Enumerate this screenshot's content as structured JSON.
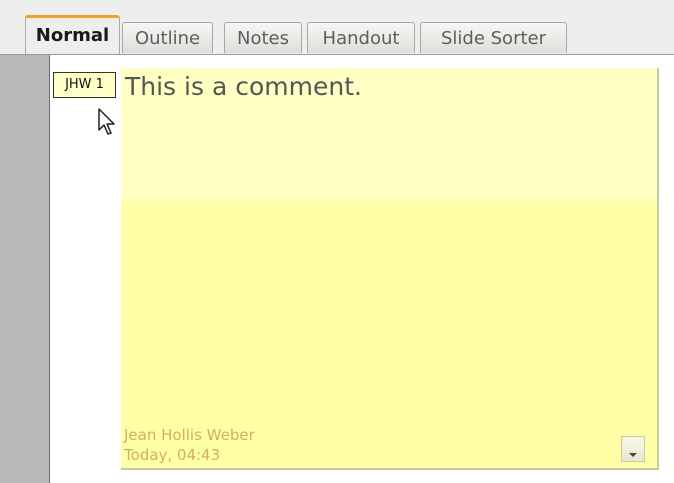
{
  "tabs": [
    {
      "label": "Normal",
      "active": true
    },
    {
      "label": "Outline",
      "active": false
    },
    {
      "label": "Notes",
      "active": false
    },
    {
      "label": "Handout",
      "active": false
    },
    {
      "label": "Slide Sorter",
      "active": false
    }
  ],
  "comment": {
    "marker": "JHW 1",
    "text": "This is a comment.",
    "author": "Jean Hollis Weber",
    "date": "Today, 04:43"
  },
  "colors": {
    "comment_background": "#ffffa8",
    "active_tab_accent": "#f0a030",
    "metadata_text": "#d0b060"
  }
}
